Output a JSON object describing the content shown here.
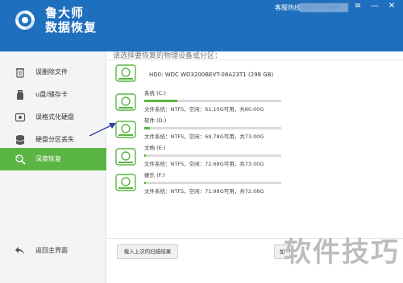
{
  "app": {
    "name_line1": "鲁大师",
    "name_line2": "数据恢复",
    "hotline_label": "客服热线：",
    "hotline_value": "400-xxx-xxxx"
  },
  "window_controls": [
    "≡",
    "—",
    "✕"
  ],
  "sidebar": {
    "items": [
      {
        "label": "误删除文件",
        "icon": "recycle-bin-icon",
        "active": false
      },
      {
        "label": "u盘/储存卡",
        "icon": "usb-drive-icon",
        "active": false
      },
      {
        "label": "误格式化硬盘",
        "icon": "hard-disk-icon",
        "active": false
      },
      {
        "label": "硬盘分区丢失",
        "icon": "database-icon",
        "active": false
      },
      {
        "label": "深度恢复",
        "icon": "deep-recovery-icon",
        "active": true
      }
    ],
    "back_label": "返回主界面"
  },
  "main": {
    "prompt": "请选择要恢复的物理设备或分区：",
    "disk_label": "HD0: WDC WD3200BEVT-08A23T1 (298 GB)",
    "partitions": [
      {
        "name": "系统 (C:)",
        "used_fraction": 0.24,
        "info": "文件系统：NTFS，空闲：61.10G可用，共80.00G"
      },
      {
        "name": "软件 (D:)",
        "used_fraction": 0.04,
        "info": "文件系统：NTFS，空闲：69.78G可用，共73.00G"
      },
      {
        "name": "文档 (E:)",
        "used_fraction": 0.004,
        "info": "文件系统：NTFS，空闲：72.68G可用，共73.00G"
      },
      {
        "name": "娱乐 (F:)",
        "used_fraction": 0.014,
        "info": "文件系统：NTFS，空闲：71.98G可用，共72.08G"
      }
    ],
    "load_button": "载入上次的扫描结果",
    "add_button": "加"
  },
  "watermark": "软件技巧",
  "colors": {
    "titlebar": "#1e6fbd",
    "accent_green": "#5bb543",
    "sidebar_bg": "#f4f4f4"
  }
}
